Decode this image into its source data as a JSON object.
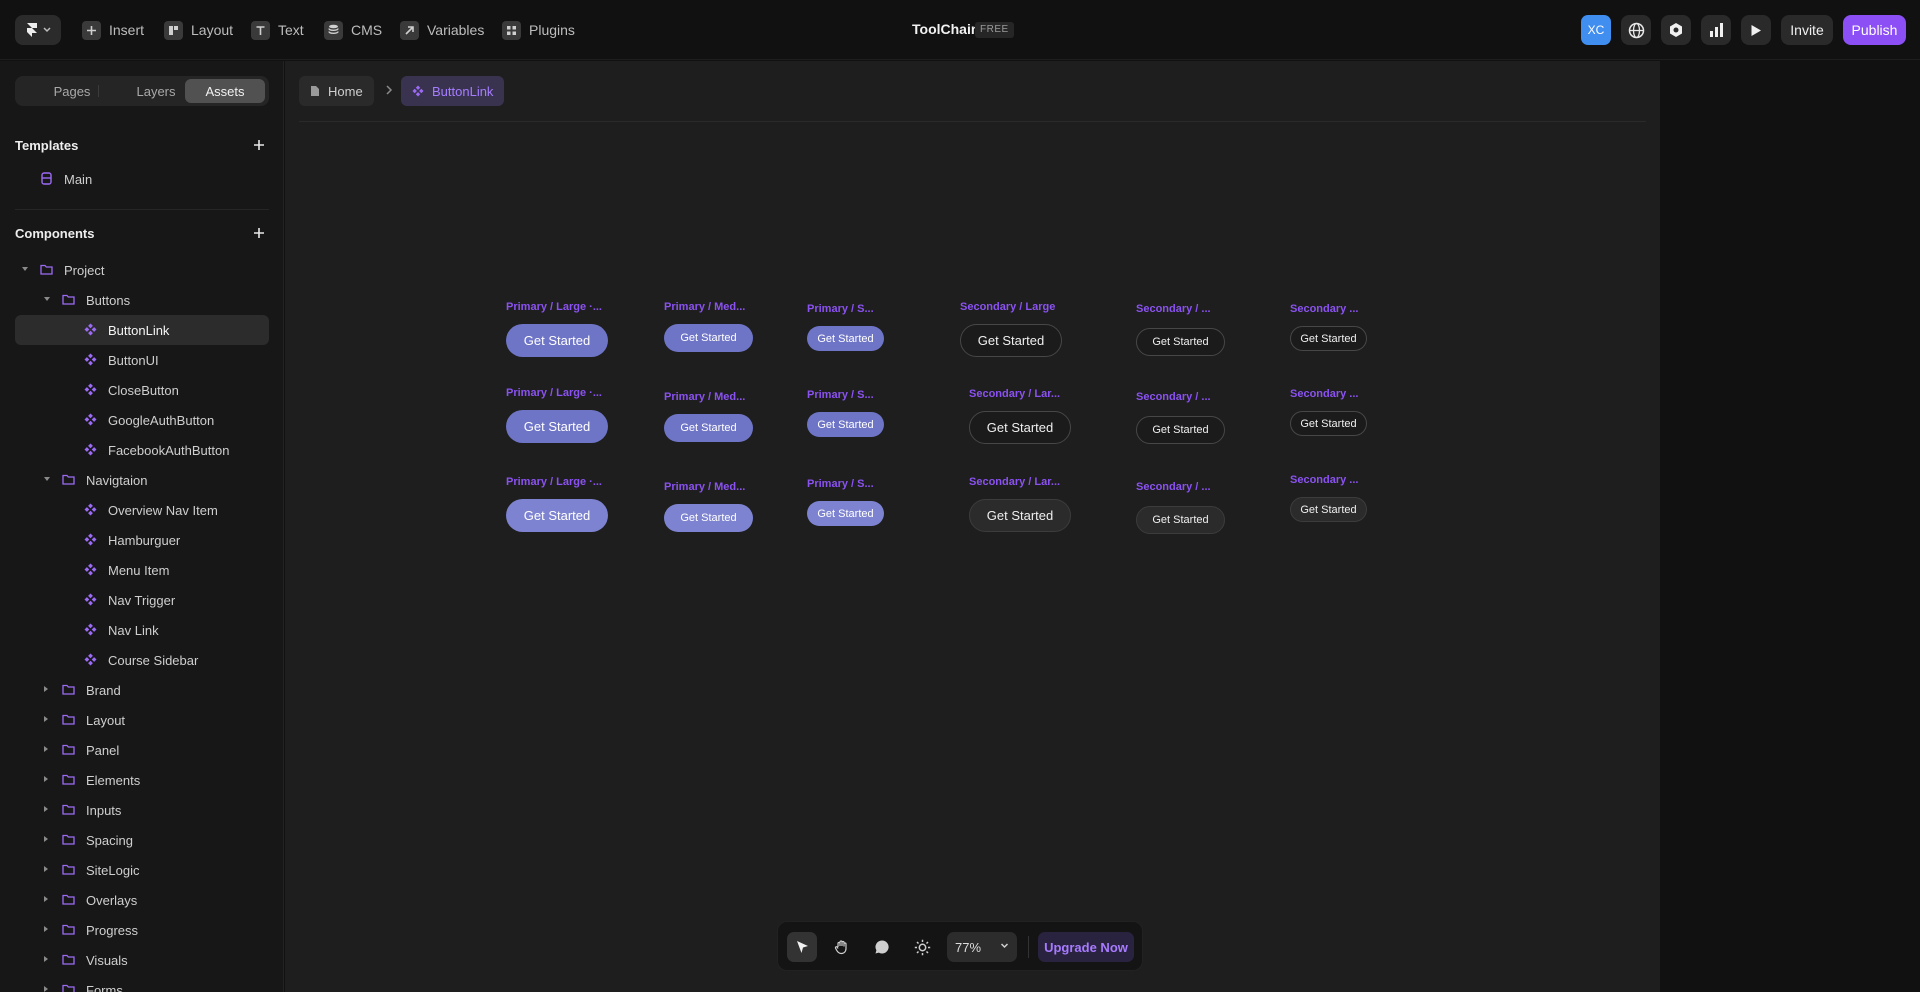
{
  "topbar": {
    "tools": [
      {
        "label": "Insert",
        "icon": "plus-square-icon"
      },
      {
        "label": "Layout",
        "icon": "layout-icon"
      },
      {
        "label": "Text",
        "icon": "text-icon"
      },
      {
        "label": "CMS",
        "icon": "database-icon"
      },
      {
        "label": "Variables",
        "icon": "variables-icon"
      },
      {
        "label": "Plugins",
        "icon": "plugins-icon"
      }
    ],
    "project_title": "ToolChain",
    "plan_badge": "FREE",
    "avatar_initials": "XC",
    "invite_label": "Invite",
    "publish_label": "Publish",
    "accent_color": "#8b4ff5"
  },
  "sidebar": {
    "tabs": [
      "Pages",
      "Layers",
      "Assets"
    ],
    "active_tab": "Assets",
    "templates_heading": "Templates",
    "templates": [
      "Main"
    ],
    "components_heading": "Components",
    "tree": [
      {
        "label": "Project",
        "type": "folder",
        "depth": 0,
        "expanded": true
      },
      {
        "label": "Buttons",
        "type": "folder",
        "depth": 1,
        "expanded": true
      },
      {
        "label": "ButtonLink",
        "type": "component",
        "depth": 2,
        "selected": true
      },
      {
        "label": "ButtonUI",
        "type": "component",
        "depth": 2
      },
      {
        "label": "CloseButton",
        "type": "component",
        "depth": 2
      },
      {
        "label": "GoogleAuthButton",
        "type": "component",
        "depth": 2
      },
      {
        "label": "FacebookAuthButton",
        "type": "component",
        "depth": 2
      },
      {
        "label": "Navigtaion",
        "type": "folder",
        "depth": 1,
        "expanded": true
      },
      {
        "label": "Overview Nav Item",
        "type": "component",
        "depth": 2
      },
      {
        "label": "Hamburguer",
        "type": "component",
        "depth": 2
      },
      {
        "label": "Menu Item",
        "type": "component",
        "depth": 2
      },
      {
        "label": "Nav Trigger",
        "type": "component",
        "depth": 2
      },
      {
        "label": "Nav Link",
        "type": "component",
        "depth": 2
      },
      {
        "label": "Course Sidebar",
        "type": "component",
        "depth": 2
      },
      {
        "label": "Brand",
        "type": "folder",
        "depth": 1,
        "expanded": false
      },
      {
        "label": "Layout",
        "type": "folder",
        "depth": 1,
        "expanded": false
      },
      {
        "label": "Panel",
        "type": "folder",
        "depth": 1,
        "expanded": false
      },
      {
        "label": "Elements",
        "type": "folder",
        "depth": 1,
        "expanded": false
      },
      {
        "label": "Inputs",
        "type": "folder",
        "depth": 1,
        "expanded": false
      },
      {
        "label": "Spacing",
        "type": "folder",
        "depth": 1,
        "expanded": false
      },
      {
        "label": "SiteLogic",
        "type": "folder",
        "depth": 1,
        "expanded": false
      },
      {
        "label": "Overlays",
        "type": "folder",
        "depth": 1,
        "expanded": false
      },
      {
        "label": "Progress",
        "type": "folder",
        "depth": 1,
        "expanded": false
      },
      {
        "label": "Visuals",
        "type": "folder",
        "depth": 1,
        "expanded": false
      },
      {
        "label": "Forms",
        "type": "folder",
        "depth": 1,
        "expanded": false
      }
    ]
  },
  "canvas": {
    "breadcrumb": [
      "Home",
      "ButtonLink"
    ],
    "variants": [
      {
        "label": "Primary / Large ·...",
        "button": "Get Started"
      },
      {
        "label": "Primary / Med...",
        "button": "Get Started"
      },
      {
        "label": "Primary / S...",
        "button": "Get Started"
      },
      {
        "label": "Secondary / Large",
        "button": "Get Started"
      },
      {
        "label": "Secondary / ...",
        "button": "Get Started"
      },
      {
        "label": "Secondary ...",
        "button": "Get Started"
      },
      {
        "label": "Primary / Large ·...",
        "button": "Get Started"
      },
      {
        "label": "Primary / Med...",
        "button": "Get Started"
      },
      {
        "label": "Primary / S...",
        "button": "Get Started"
      },
      {
        "label": "Secondary / Lar...",
        "button": "Get Started"
      },
      {
        "label": "Secondary / ...",
        "button": "Get Started"
      },
      {
        "label": "Secondary ...",
        "button": "Get Started"
      },
      {
        "label": "Primary / Large ·...",
        "button": "Get Started"
      },
      {
        "label": "Primary / Med...",
        "button": "Get Started"
      },
      {
        "label": "Primary / S...",
        "button": "Get Started"
      },
      {
        "label": "Secondary / Lar...",
        "button": "Get Started"
      },
      {
        "label": "Secondary / ...",
        "button": "Get Started"
      },
      {
        "label": "Secondary ...",
        "button": "Get Started"
      }
    ]
  },
  "bottombar": {
    "tools": [
      "pointer-icon",
      "hand-icon",
      "comment-icon",
      "sun-icon"
    ],
    "zoom": "77%",
    "upgrade_label": "Upgrade Now"
  }
}
